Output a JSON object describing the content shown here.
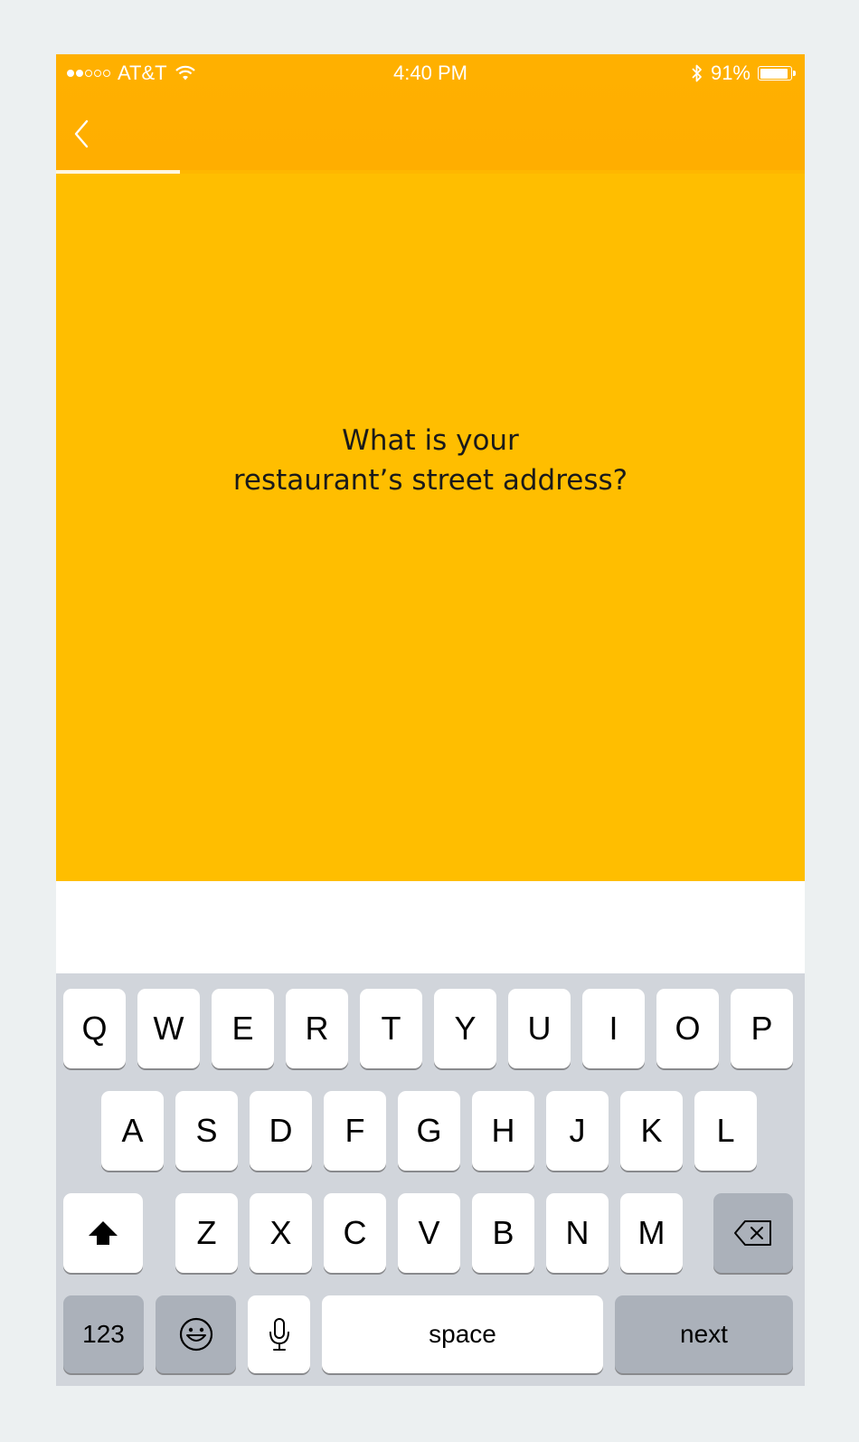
{
  "status_bar": {
    "carrier": "AT&T",
    "signal_dots_filled": 2,
    "signal_dots_total": 5,
    "time": "4:40 PM",
    "battery_percent": "91%",
    "battery_level": 0.91
  },
  "nav": {
    "back_icon": "chevron-left-icon",
    "progress": 0.165
  },
  "question": {
    "line1": "What is your",
    "line2": "restaurant’s street address?"
  },
  "keyboard": {
    "row1": [
      "Q",
      "W",
      "E",
      "R",
      "T",
      "Y",
      "U",
      "I",
      "O",
      "P"
    ],
    "row2": [
      "A",
      "S",
      "D",
      "F",
      "G",
      "H",
      "J",
      "K",
      "L"
    ],
    "row3": [
      "Z",
      "X",
      "C",
      "V",
      "B",
      "N",
      "M"
    ],
    "shift_icon": "shift-arrow-icon",
    "delete_icon": "backspace-icon",
    "numbers_label": "123",
    "emoji_icon": "emoji-icon",
    "mic_icon": "microphone-icon",
    "space_label": "space",
    "return_label": "next"
  },
  "colors": {
    "header": "#ffb000",
    "panel": "#ffbe00",
    "keyboard_bg": "#d1d5db",
    "function_key": "#abb1ba"
  }
}
